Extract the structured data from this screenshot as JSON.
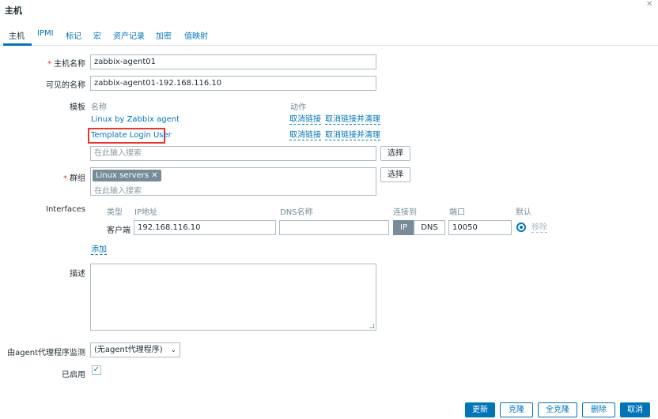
{
  "dialog": {
    "title": "主机",
    "close_icon": "close-icon"
  },
  "tabs": [
    {
      "label": "主机",
      "active": true
    },
    {
      "label": "IPMI"
    },
    {
      "label": "标记"
    },
    {
      "label": "宏"
    },
    {
      "label": "资产记录"
    },
    {
      "label": "加密"
    },
    {
      "label": "值映射"
    }
  ],
  "form": {
    "host_name": {
      "label": "主机名称",
      "value": "zabbix-agent01"
    },
    "visible_name": {
      "label": "可见的名称",
      "value": "zabbix-agent01-192.168.116.10"
    },
    "templates": {
      "label": "模板",
      "col_name": "名称",
      "col_action": "动作",
      "rows": [
        {
          "name": "Linux by Zabbix agent",
          "unlink": "取消链接",
          "unlink_clear": "取消链接并清理"
        },
        {
          "name": "Template Login User",
          "unlink": "取消链接",
          "unlink_clear": "取消链接并清理"
        }
      ],
      "search_placeholder": "在此输入搜索",
      "select_label": "选择"
    },
    "groups": {
      "label": "群组",
      "tag": "Linux servers",
      "tag_remove": "✕",
      "search_placeholder": "在此输入搜索",
      "select_label": "选择"
    },
    "interfaces": {
      "label": "Interfaces",
      "headers": {
        "type": "类型",
        "ip": "IP地址",
        "dns": "DNS名称",
        "connect": "连接到",
        "port": "端口",
        "default": "默认"
      },
      "row": {
        "type": "客户端",
        "ip": "192.168.116.10",
        "dns": "",
        "connect_ip": "IP",
        "connect_dns": "DNS",
        "port": "10050",
        "remove": "移除"
      },
      "add": "添加"
    },
    "description": {
      "label": "描述"
    },
    "proxy": {
      "label": "由agent代理程序监测",
      "value": "(无agent代理程序)"
    },
    "enabled": {
      "label": "已启用",
      "check": "✓"
    }
  },
  "footer": {
    "update": "更新",
    "clone": "克隆",
    "full_clone": "全克隆",
    "delete": "删除",
    "cancel": "取消"
  }
}
